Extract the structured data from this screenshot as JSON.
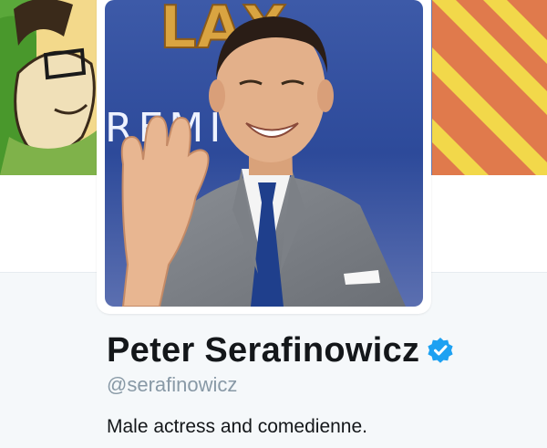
{
  "profile": {
    "name": "Peter Serafinowicz",
    "screen_name": "@serafinowicz",
    "bio": "Male actress and comedienne.",
    "verified": true
  },
  "avatar": {
    "backdrop_text_top": "LAX",
    "backdrop_text_bottom": "REMI E"
  },
  "icons": {
    "verified": "verified-badge-icon"
  },
  "colors": {
    "verified_blue": "#1da1f2",
    "name_text": "#14171a",
    "secondary_text": "#8899a6",
    "page_bg": "#f5f8fa"
  }
}
